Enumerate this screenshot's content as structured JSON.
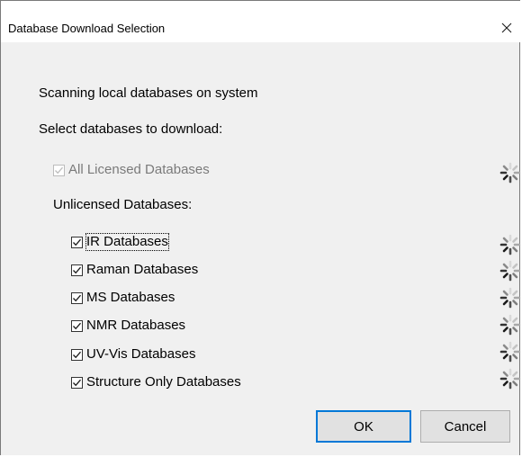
{
  "window": {
    "title": "Database Download Selection",
    "close_icon": "close-icon"
  },
  "main": {
    "status_text": "Scanning local databases on system",
    "prompt_text": "Select databases to download:",
    "all_licensed": {
      "label": "All Licensed Databases",
      "checked": true,
      "enabled": false
    },
    "unlicensed_heading": "Unlicensed Databases:",
    "unlicensed_items": [
      {
        "label": "IR Databases",
        "checked": true
      },
      {
        "label": "Raman Databases",
        "checked": true
      },
      {
        "label": "MS Databases",
        "checked": true
      },
      {
        "label": "NMR Databases",
        "checked": true
      },
      {
        "label": "UV-Vis Databases",
        "checked": true
      },
      {
        "label": "Structure Only Databases",
        "checked": true
      }
    ],
    "spinner_icon": "loading-spinner-icon"
  },
  "buttons": {
    "ok_label": "OK",
    "cancel_label": "Cancel"
  },
  "colors": {
    "accent": "#0078d7",
    "dialog_background": "#f0f0f0",
    "disabled_text": "#7a7a7a"
  }
}
